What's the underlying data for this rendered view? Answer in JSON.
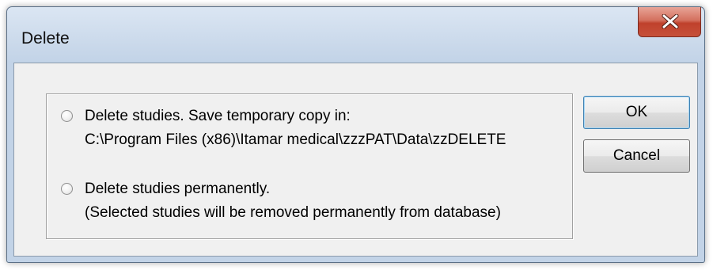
{
  "window": {
    "title": "Delete"
  },
  "icons": {
    "close": "close-icon"
  },
  "colors": {
    "close_button": "#c6503a",
    "title_bar": "#c9d8ea",
    "client_bg": "#f0f0f0",
    "ok_border": "#3c7fb1"
  },
  "options": [
    {
      "label": "Delete studies. Save temporary copy in:",
      "detail": "C:\\Program Files (x86)\\Itamar medical\\zzzPAT\\Data\\zzDELETE",
      "selected": false
    },
    {
      "label": "Delete studies permanently.",
      "detail": "(Selected studies will be removed permanently from database)",
      "selected": false
    }
  ],
  "buttons": {
    "ok": "OK",
    "cancel": "Cancel"
  }
}
